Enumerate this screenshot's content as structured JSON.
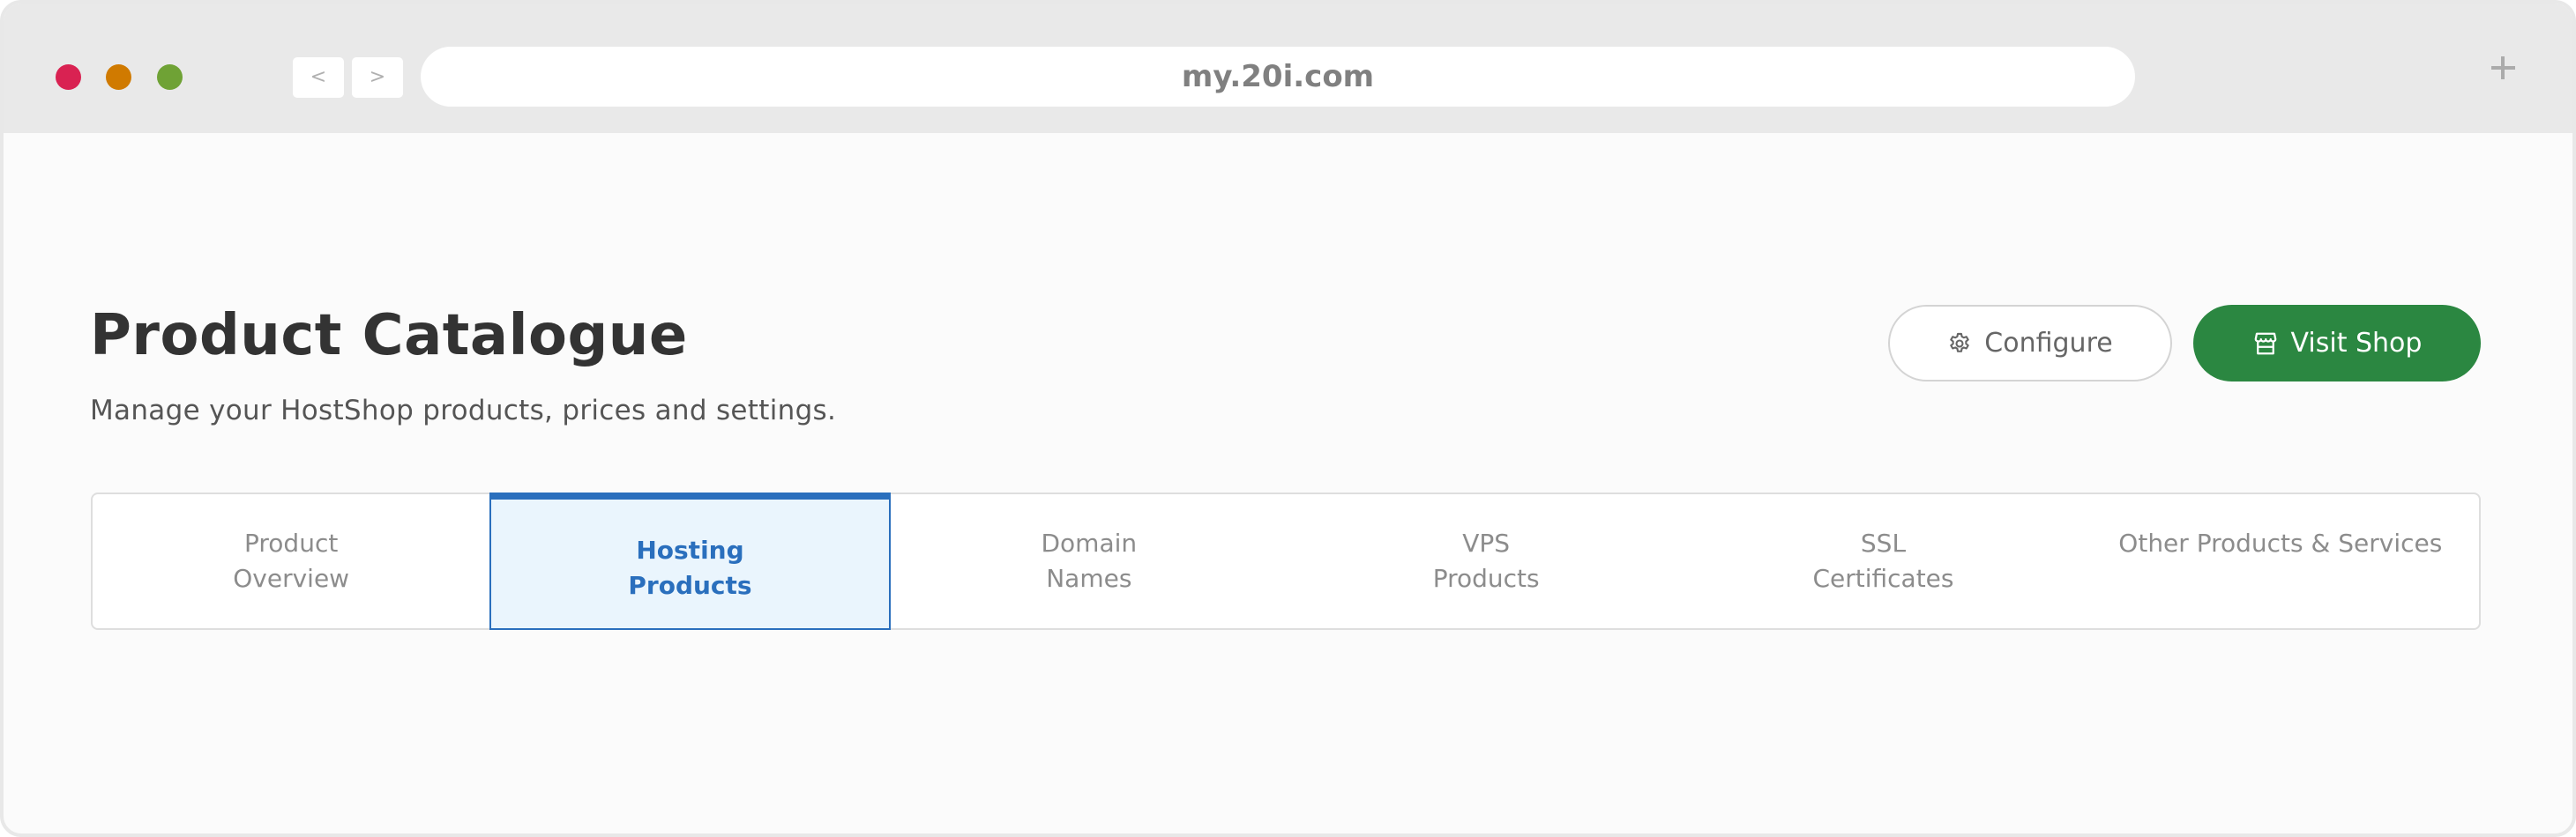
{
  "browser": {
    "url": "my.20i.com",
    "back_label": "<",
    "forward_label": ">",
    "window_controls": [
      {
        "name": "close",
        "color": "#d92252"
      },
      {
        "name": "minimize",
        "color": "#d07a00"
      },
      {
        "name": "maximize",
        "color": "#6fa235"
      }
    ],
    "new_tab_icon": "plus-icon"
  },
  "header": {
    "title": "Product Catalogue",
    "subtitle": "Manage your HostShop products, prices and settings.",
    "configure": {
      "label": "Configure",
      "icon": "gear-icon"
    },
    "visit_shop": {
      "label": "Visit Shop",
      "icon": "store-icon",
      "color": "#2b8741"
    }
  },
  "tabs": [
    {
      "lines": [
        "Product",
        "Overview"
      ],
      "active": false
    },
    {
      "lines": [
        "Hosting",
        "Products"
      ],
      "active": true
    },
    {
      "lines": [
        "Domain",
        "Names"
      ],
      "active": false
    },
    {
      "lines": [
        "VPS",
        "Products"
      ],
      "active": false
    },
    {
      "lines": [
        "SSL",
        "Certificates"
      ],
      "active": false
    },
    {
      "lines": [
        "Other Products & Services"
      ],
      "active": false
    }
  ],
  "theme": {
    "active_tab_color": "#2a6fbd",
    "active_tab_bg": "#eaf5fd"
  }
}
